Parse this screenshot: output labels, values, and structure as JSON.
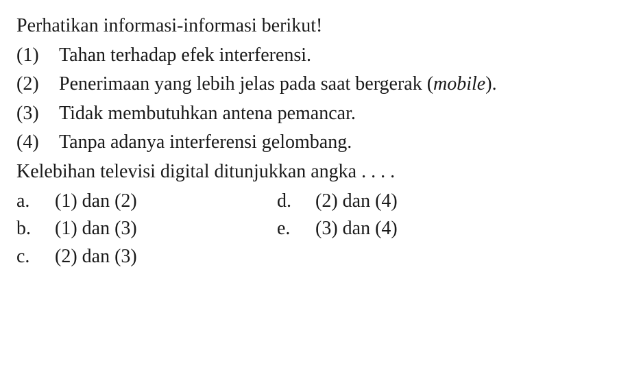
{
  "intro": "Perhatikan informasi-informasi berikut!",
  "items": [
    {
      "number": "(1)",
      "text": "Tahan terhadap efek interferensi."
    },
    {
      "number": "(2)",
      "text_before": "Penerimaan yang lebih jelas pada saat bergerak (",
      "italic": "mobile",
      "text_after": ")."
    },
    {
      "number": "(3)",
      "text": "Tidak membutuhkan antena pemancar."
    },
    {
      "number": "(4)",
      "text": "Tanpa adanya interferensi gelombang."
    }
  ],
  "question": "Kelebihan televisi digital ditunjukkan angka . . . .",
  "options": {
    "a": {
      "letter": "a.",
      "text": "(1) dan (2)"
    },
    "b": {
      "letter": "b.",
      "text": "(1) dan (3)"
    },
    "c": {
      "letter": "c.",
      "text": "(2) dan (3)"
    },
    "d": {
      "letter": "d.",
      "text": "(2) dan (4)"
    },
    "e": {
      "letter": "e.",
      "text": "(3) dan (4)"
    }
  }
}
